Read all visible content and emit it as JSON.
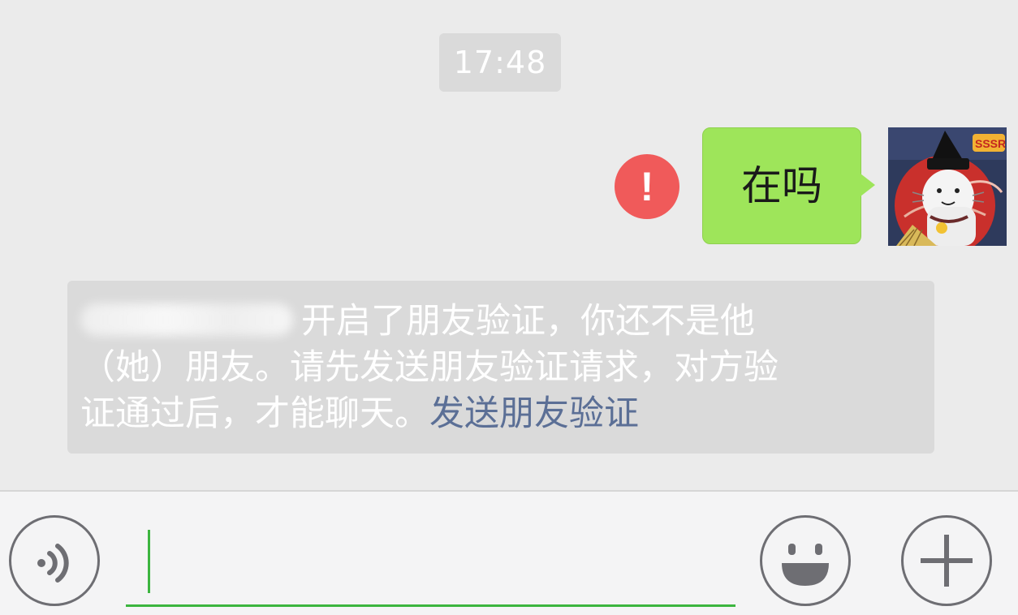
{
  "chat": {
    "timestamp": "17:48",
    "outgoing_message": {
      "text": "在吗",
      "status": "failed",
      "error_symbol": "!"
    },
    "system_notice": {
      "line1_text": "开启了朋友验证，你还不是他",
      "line2_text": "（她）朋友。请先发送朋友验证请求，对方验",
      "line3_text": "证通过后，才能聊天。",
      "link_text": "发送朋友验证"
    }
  },
  "input_bar": {
    "input_value": "",
    "voice_icon": "voice-icon",
    "emoji_icon": "smiley-icon",
    "more_icon": "plus-icon"
  },
  "colors": {
    "chat_background": "#ebebeb",
    "bubble_green": "#9ee55a",
    "error_red": "#f05a5a",
    "notice_background": "#dadada",
    "link_blue": "#5b6f96",
    "input_accent": "#3cb53f"
  }
}
